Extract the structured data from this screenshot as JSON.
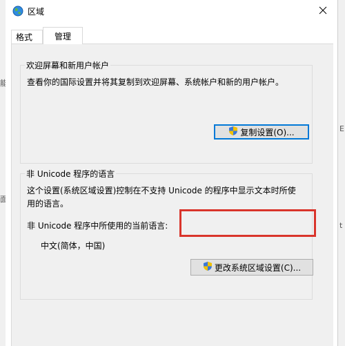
{
  "window": {
    "title": "区域",
    "icon": "globe-icon",
    "close_icon": "close-icon"
  },
  "tabs": [
    {
      "label": "格式",
      "active": false
    },
    {
      "label": "管理",
      "active": true
    }
  ],
  "welcome_group": {
    "label": "欢迎屏幕和新用户帐户",
    "description": "查看你的国际设置并将其复制到欢迎屏幕、系统帐户和新的用户帐户。",
    "copy_button": "复制设置(O)...",
    "button_icon": "shield-icon"
  },
  "unicode_group": {
    "label": "非 Unicode 程序的语言",
    "description_line1": "这个设置(系统区域设置)控制在不支持 Unicode 的程序中显示文本时所使",
    "description_line2": "用的语言。",
    "current_label": "非 Unicode 程序中所使用的当前语言:",
    "current_value": "中文(简体，中国)",
    "change_button": "更改系统区域设置(C)...",
    "button_icon": "shield-icon"
  },
  "highlight_color": "#d9342b",
  "background_fragments": {
    "left": [
      "能",
      "面"
    ],
    "right": [
      "E",
      "t"
    ]
  }
}
